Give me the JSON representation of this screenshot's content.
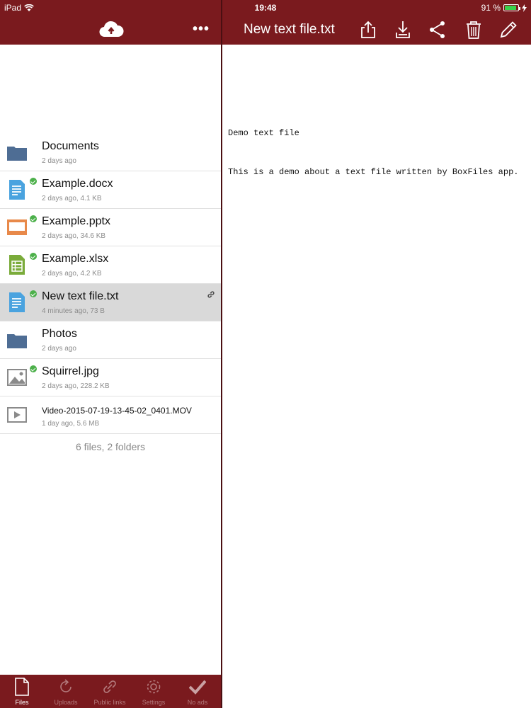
{
  "status": {
    "carrier": "iPad",
    "time": "19:48",
    "battery": "91 %",
    "battery_level": 0.91
  },
  "left_header": {
    "cloud_icon": "cloud-icon",
    "more_label": "•••"
  },
  "right_header": {
    "title": "New text file.txt",
    "icons": [
      "upload-icon",
      "download-icon",
      "share-icon",
      "trash-icon",
      "pencil-icon"
    ]
  },
  "files": [
    {
      "name": "Documents",
      "meta": "2 days ago",
      "type": "folder",
      "synced": false
    },
    {
      "name": "Example.docx",
      "meta": "2 days ago, 4.1 KB",
      "type": "docx",
      "synced": true
    },
    {
      "name": "Example.pptx",
      "meta": "2 days ago, 34.6 KB",
      "type": "pptx",
      "synced": true
    },
    {
      "name": "Example.xlsx",
      "meta": "2 days ago, 4.2 KB",
      "type": "xlsx",
      "synced": true
    },
    {
      "name": "New text file.txt",
      "meta": "4 minutes ago, 73 B",
      "type": "txt",
      "synced": true,
      "selected": true
    },
    {
      "name": "Photos",
      "meta": "2 days ago",
      "type": "folder",
      "synced": false
    },
    {
      "name": "Squirrel.jpg",
      "meta": "2 days ago, 228.2 KB",
      "type": "image",
      "synced": true
    },
    {
      "name": "Video-2015-07-19-13-45-02_0401.MOV",
      "meta": "1 day ago, 5.6 MB",
      "type": "video",
      "synced": false
    }
  ],
  "summary": "6 files, 2 folders",
  "document": {
    "line1": "Demo text file",
    "line2": "This is a demo about a text file written by BoxFiles app."
  },
  "tabs": [
    {
      "label": "Files",
      "icon": "file-icon",
      "active": true
    },
    {
      "label": "Uploads",
      "icon": "refresh-icon",
      "active": false
    },
    {
      "label": "Public links",
      "icon": "link-icon",
      "active": false
    },
    {
      "label": "Settings",
      "icon": "gear-icon",
      "active": false
    },
    {
      "label": "No ads",
      "icon": "checkmark-icon",
      "active": false
    }
  ],
  "colors": {
    "brand": "#7a1a1e",
    "synced": "#4cb04a",
    "folder": "#4e6d94",
    "doc": "#4aa3df",
    "ppt": "#e8894a",
    "xls": "#7aab3a"
  }
}
